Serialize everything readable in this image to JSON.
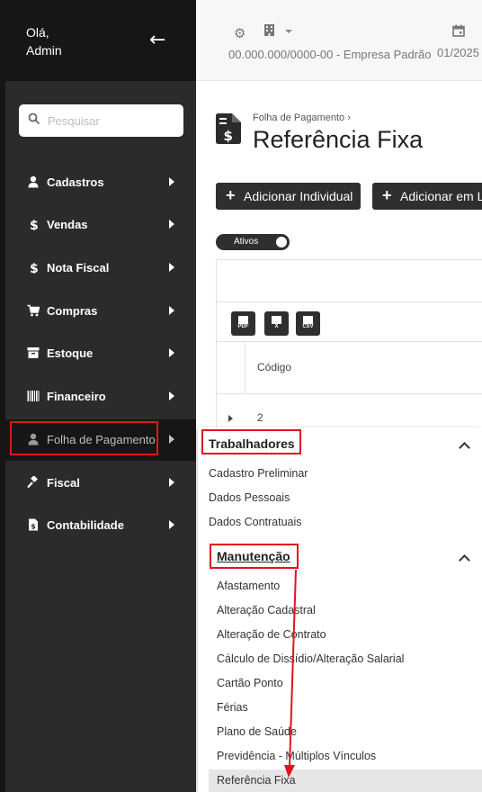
{
  "sidebar": {
    "greeting_line1": "Olá,",
    "greeting_line2": "Admin",
    "back_icon": "arrow-left-icon",
    "search_placeholder": "Pesquisar",
    "items": [
      {
        "label": "Cadastros",
        "icon": "user-icon"
      },
      {
        "label": "Vendas",
        "icon": "dollar-icon"
      },
      {
        "label": "Nota Fiscal",
        "icon": "dollar-icon"
      },
      {
        "label": "Compras",
        "icon": "cart-icon"
      },
      {
        "label": "Estoque",
        "icon": "archive-icon"
      },
      {
        "label": "Financeiro",
        "icon": "barcode-icon"
      },
      {
        "label": "Folha de Pagamento",
        "icon": "user-icon"
      },
      {
        "label": "Fiscal",
        "icon": "gavel-icon"
      },
      {
        "label": "Contabilidade",
        "icon": "file-invoice-icon"
      }
    ]
  },
  "header": {
    "company": "00.000.000/0000-00 - Empresa Padrão",
    "period": "01/2025"
  },
  "main": {
    "breadcrumb": "Folha de Pagamento",
    "title": "Referência Fixa",
    "add_individual_label": "Adicionar Individual",
    "add_batch_label": "Adicionar em Lo",
    "toggle_label": "Ativos",
    "export_formats": [
      "PDF",
      "X",
      "CSV"
    ],
    "column_code": "Código",
    "first_row_code": "2"
  },
  "flyout": {
    "section1_title": "Trabalhadores",
    "section1_items": [
      "Cadastro Preliminar",
      "Dados Pessoais",
      "Dados Contratuais"
    ],
    "section2_title": "Manutenção",
    "section2_items": [
      "Afastamento",
      "Alteração Cadastral",
      "Alteração de Contrato",
      "Cálculo de Dissídio/Alteração Salarial",
      "Cartão Ponto",
      "Férias",
      "Plano de Saúde",
      "Previdência - Múltiplos Vínculos",
      "Referência Fixa"
    ]
  },
  "colors": {
    "sidebar_bg": "#2b2b2b",
    "sidebar_dark": "#161616",
    "button_dark": "#2f2f2f",
    "highlight_red": "#e0141e"
  }
}
